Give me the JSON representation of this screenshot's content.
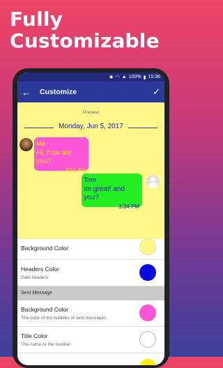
{
  "headline": {
    "line1": "Fully",
    "line2": "Customizable"
  },
  "status_bar": {
    "icons": [
      "bluetooth-icon",
      "wifi-icon",
      "signal-icon"
    ],
    "battery": "100%",
    "time": "15:36"
  },
  "app_bar": {
    "back_icon": "back-arrow-icon",
    "title": "Customize",
    "confirm_icon": "check-icon"
  },
  "preview": {
    "label": "Preview",
    "date": "Monday, Jun 5, 2017",
    "messages": [
      {
        "name": "Me",
        "text": "Hi, how are you?",
        "time": "3:34 PM",
        "bubble_color": "#ff55d6",
        "text_color": "#ffee00"
      },
      {
        "name": "Tom",
        "text": "Im great! and you?",
        "time": "3:34 PM",
        "bubble_color": "#22ee22",
        "text_color": "#1a1ab0"
      }
    ],
    "background_color": "#fff78a"
  },
  "settings": {
    "background_color": {
      "title": "Background Color",
      "color": "#fff78a"
    },
    "headers_color": {
      "title": "Headers Color",
      "subtitle": "Date headers",
      "color": "#0a0ae0"
    },
    "section_sent": "Sent Message",
    "sent_background": {
      "title": "Background Color",
      "subtitle": "The color of the bubbles of sent messages.",
      "color": "#ff55d6"
    },
    "title_color": {
      "title": "Title Color",
      "subtitle": "The name or the number",
      "color": "#ffffff"
    }
  }
}
